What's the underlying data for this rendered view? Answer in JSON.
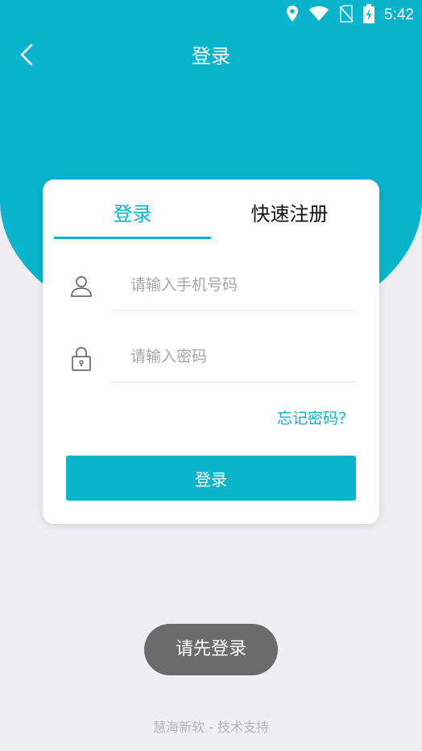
{
  "status_bar": {
    "time": "5:42",
    "icons": [
      "location-icon",
      "wifi-icon",
      "no-sim-icon",
      "battery-charging-icon"
    ]
  },
  "header": {
    "title": "登录",
    "back_icon": "chevron-left-icon"
  },
  "tabs": [
    {
      "label": "登录",
      "active": true
    },
    {
      "label": "快速注册",
      "active": false
    }
  ],
  "form": {
    "phone_placeholder": "请输入手机号码",
    "phone_value": "",
    "phone_icon": "user-icon",
    "password_placeholder": "请输入密码",
    "password_value": "",
    "password_icon": "lock-icon",
    "forgot_label": "忘记密码？",
    "submit_label": "登录"
  },
  "toast": {
    "message": "请先登录"
  },
  "footer": {
    "text": "慧海新软 - 技术支持"
  },
  "colors": {
    "accent": "#0ab4cc",
    "background": "#efeef3",
    "toast": "#6b6b6b",
    "footer_text": "#b5b5b5"
  }
}
